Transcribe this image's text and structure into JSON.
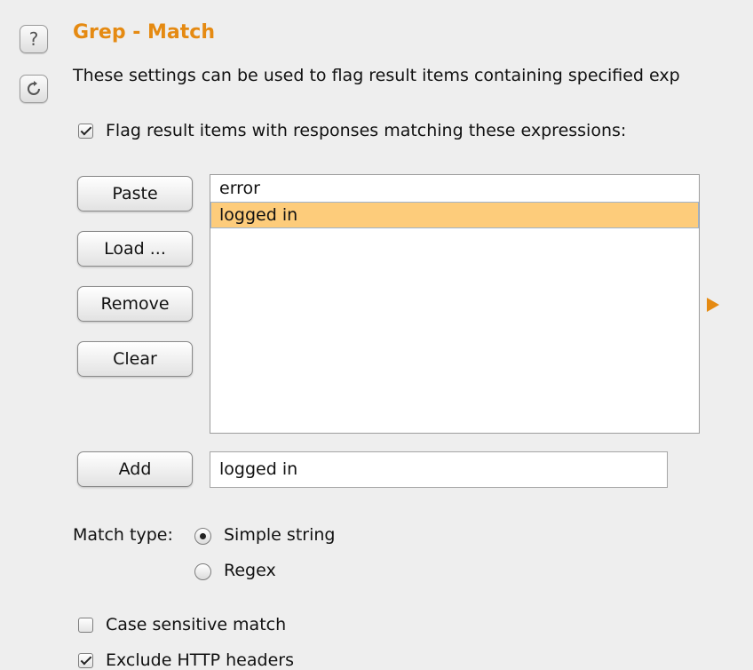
{
  "section": {
    "title": "Grep - Match",
    "description": "These settings can be used to flag result items containing specified exp",
    "help_icon": "question-mark",
    "reset_icon": "reset-arrow"
  },
  "flag_option": {
    "label": "Flag result items with responses matching these expressions:",
    "checked": true
  },
  "buttons": {
    "paste": "Paste",
    "load": "Load ...",
    "remove": "Remove",
    "clear": "Clear",
    "add": "Add"
  },
  "expressions": [
    {
      "text": "error",
      "selected": false
    },
    {
      "text": "logged in",
      "selected": true
    }
  ],
  "add_input": {
    "value": "logged in"
  },
  "match_type": {
    "label": "Match type:",
    "options": [
      {
        "label": "Simple string",
        "selected": true
      },
      {
        "label": "Regex",
        "selected": false
      }
    ]
  },
  "case_sensitive": {
    "label": "Case sensitive match",
    "checked": false
  },
  "exclude_headers": {
    "label": "Exclude HTTP headers",
    "checked": true
  },
  "colors": {
    "accent": "#e58a12",
    "selection": "#fdcc7b"
  }
}
